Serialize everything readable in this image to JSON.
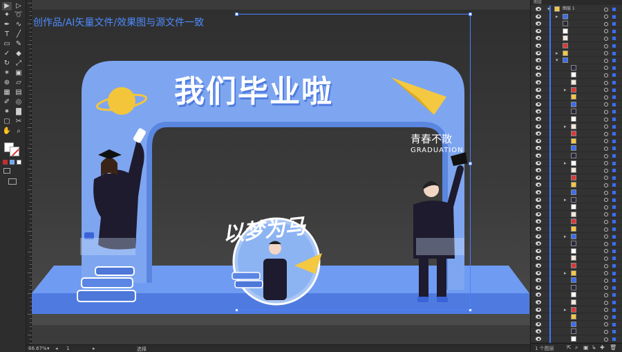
{
  "canvas": {
    "title_annotation": "创作品/AI矢量文件/效果图与源文件一致"
  },
  "artwork": {
    "main_title": "我们毕业啦",
    "circle_text": "以梦为马",
    "right_text_cn": "青春不散",
    "right_text_en": "GRADUATION",
    "colors": {
      "arch": "#7ea6f0",
      "arch_edge": "#5a86e0",
      "stage": "#6f9cf2",
      "stage_front": "#4f7be0",
      "planet": "#f3c53a",
      "plane": "#f5c842",
      "gown": "#1e1b2e"
    }
  },
  "statusbar": {
    "zoom": "66.67%",
    "artboard": "1",
    "tool": "选择"
  },
  "layers": {
    "header": "图层",
    "layer_name": "图层 1",
    "footer_count": "1 个图层"
  },
  "tools": [
    "selection-tool",
    "direct-selection-tool",
    "magic-wand-tool",
    "lasso-tool",
    "pen-tool",
    "curvature-tool",
    "type-tool",
    "line-tool",
    "rectangle-tool",
    "paintbrush-tool",
    "shaper-tool",
    "eraser-tool",
    "rotate-tool",
    "scale-tool",
    "width-tool",
    "free-transform-tool",
    "shape-builder-tool",
    "perspective-tool",
    "mesh-tool",
    "gradient-tool",
    "eyedropper-tool",
    "blend-tool",
    "symbol-sprayer-tool",
    "column-graph-tool",
    "artboard-tool",
    "slice-tool",
    "hand-tool",
    "zoom-tool"
  ]
}
